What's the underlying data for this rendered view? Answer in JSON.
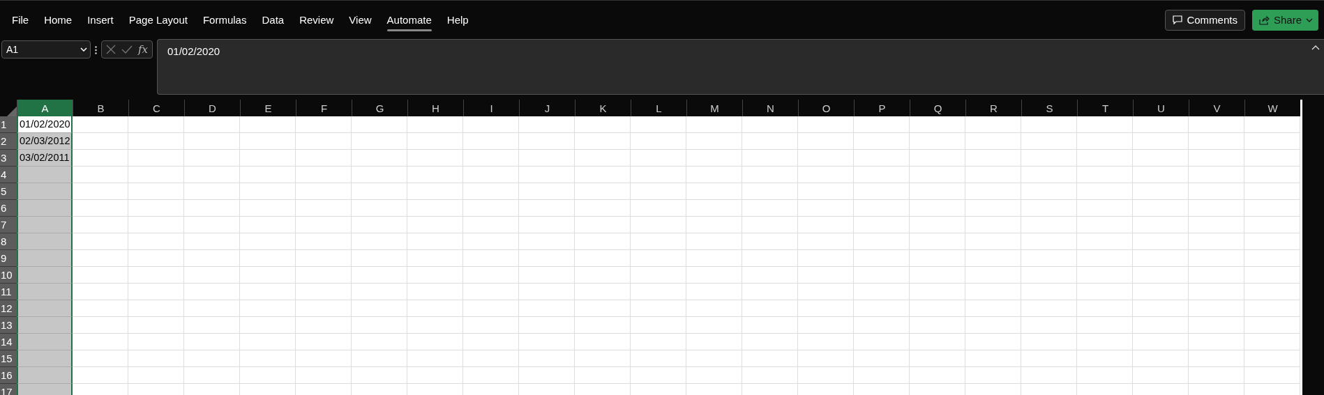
{
  "menu_tabs": [
    {
      "label": "File",
      "selected": false
    },
    {
      "label": "Home",
      "selected": false
    },
    {
      "label": "Insert",
      "selected": false
    },
    {
      "label": "Page Layout",
      "selected": false
    },
    {
      "label": "Formulas",
      "selected": false
    },
    {
      "label": "Data",
      "selected": false
    },
    {
      "label": "Review",
      "selected": false
    },
    {
      "label": "View",
      "selected": false
    },
    {
      "label": "Automate",
      "selected": true
    },
    {
      "label": "Help",
      "selected": false
    }
  ],
  "comments_button": {
    "label": "Comments"
  },
  "share_button": {
    "label": "Share"
  },
  "formula_bar": {
    "name_box": "A1",
    "function_label": "fx",
    "formula": "01/02/2020"
  },
  "sheet": {
    "columns": [
      {
        "label": "A",
        "selected": true
      },
      {
        "label": "B",
        "selected": false
      },
      {
        "label": "C",
        "selected": false
      },
      {
        "label": "D",
        "selected": false
      },
      {
        "label": "E",
        "selected": false
      },
      {
        "label": "F",
        "selected": false
      },
      {
        "label": "G",
        "selected": false
      },
      {
        "label": "H",
        "selected": false
      },
      {
        "label": "I",
        "selected": false
      },
      {
        "label": "J",
        "selected": false
      },
      {
        "label": "K",
        "selected": false
      },
      {
        "label": "L",
        "selected": false
      },
      {
        "label": "M",
        "selected": false
      },
      {
        "label": "N",
        "selected": false
      },
      {
        "label": "O",
        "selected": false
      },
      {
        "label": "P",
        "selected": false
      },
      {
        "label": "Q",
        "selected": false
      },
      {
        "label": "R",
        "selected": false
      },
      {
        "label": "S",
        "selected": false
      },
      {
        "label": "T",
        "selected": false
      },
      {
        "label": "U",
        "selected": false
      },
      {
        "label": "V",
        "selected": false
      },
      {
        "label": "W",
        "selected": false
      }
    ],
    "rows": [
      {
        "label": "1",
        "cell": {
          "value": "01/02/2020",
          "active": true
        }
      },
      {
        "label": "2",
        "cell": {
          "value": "02/03/2012",
          "active": false
        }
      },
      {
        "label": "3",
        "cell": {
          "value": "03/02/2011",
          "active": false
        }
      },
      {
        "label": "4",
        "cell": {
          "active": false
        }
      },
      {
        "label": "5",
        "cell": {
          "active": false
        }
      },
      {
        "label": "6",
        "cell": {
          "active": false
        }
      },
      {
        "label": "7",
        "cell": {
          "active": false
        }
      },
      {
        "label": "8",
        "cell": {
          "active": false
        }
      },
      {
        "label": "9",
        "cell": {
          "active": false
        }
      },
      {
        "label": "10",
        "cell": {
          "active": false
        }
      },
      {
        "label": "11",
        "cell": {
          "active": false
        }
      },
      {
        "label": "12",
        "cell": {
          "active": false
        }
      },
      {
        "label": "13",
        "cell": {
          "active": false
        }
      },
      {
        "label": "14",
        "cell": {
          "active": false
        }
      },
      {
        "label": "15",
        "cell": {
          "active": false
        }
      },
      {
        "label": "16",
        "cell": {
          "active": false
        }
      },
      {
        "label": "17",
        "cell": {
          "active": false
        }
      }
    ]
  }
}
